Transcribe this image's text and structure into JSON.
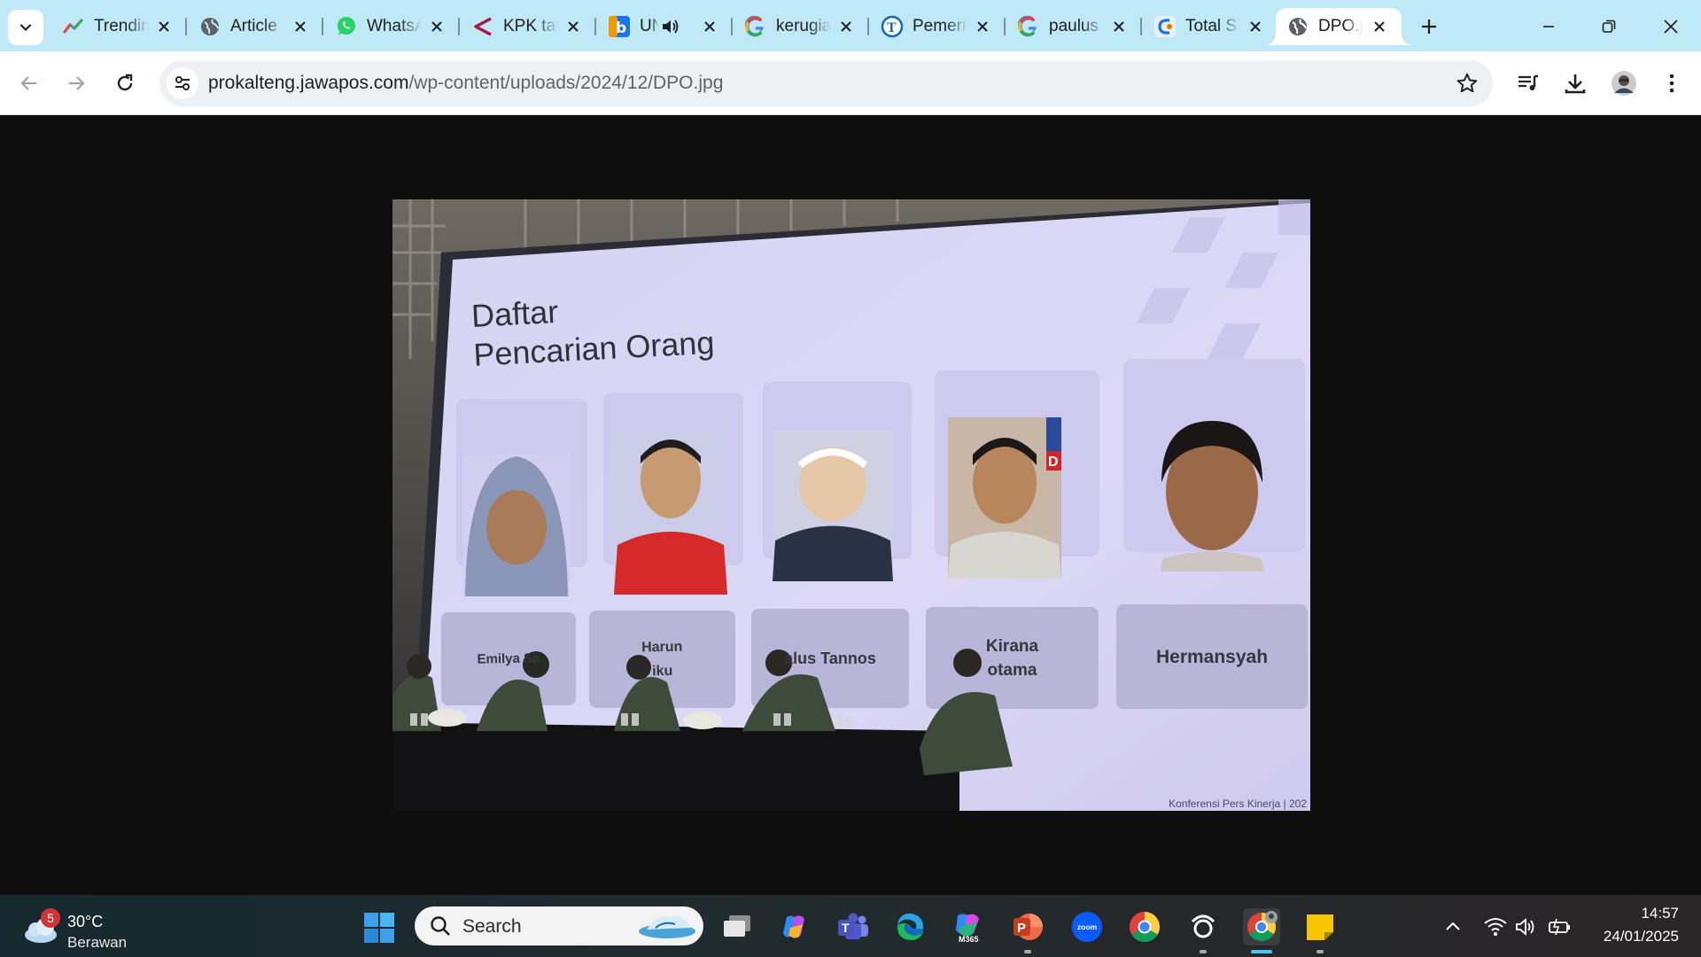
{
  "browser": {
    "tabs": [
      {
        "title": "Trending",
        "icon": "trends-icon"
      },
      {
        "title": "Article",
        "icon": "globe-icon"
      },
      {
        "title": "WhatsApp",
        "icon": "whatsapp-icon"
      },
      {
        "title": "KPK tangkap",
        "icon": "news-arrow-icon"
      },
      {
        "title": "UNGGAH",
        "icon": "site-b-icon",
        "audio": true
      },
      {
        "title": "kerugian",
        "icon": "google-icon"
      },
      {
        "title": "Pemerintah",
        "icon": "tribun-icon"
      },
      {
        "title": "paulus",
        "icon": "google-icon"
      },
      {
        "title": "Total S",
        "icon": "site-logo-icon"
      },
      {
        "title": "DPO.jpg",
        "icon": "globe-icon",
        "active": true
      }
    ],
    "address": {
      "host": "prokalteng.jawapos.com",
      "path": "/wp-content/uploads/2024/12/DPO.jpg"
    }
  },
  "photo": {
    "slide_title": "Daftar\nPencarian Orang",
    "people": [
      {
        "name": "Emilya Sa"
      },
      {
        "name": "Harun\niku"
      },
      {
        "name": "alus Tannos"
      },
      {
        "name": "Kirana\notama"
      },
      {
        "name": "Hermansyah"
      }
    ],
    "badge_letter": "D",
    "caption": "Konferensi Pers Kinerja | 202"
  },
  "taskbar": {
    "weather": {
      "badge": "5",
      "temp": "30°C",
      "desc": "Berawan"
    },
    "search_placeholder": "Search",
    "zoom_label": "zoom",
    "m365_label": "M365",
    "ppt_label": "P",
    "time": "14:57",
    "date": "24/01/2025"
  },
  "colors": {
    "tabstrip": "#bfe9f6",
    "accent": "#4cc2ff",
    "slide_bg": "#d8d4f3"
  }
}
